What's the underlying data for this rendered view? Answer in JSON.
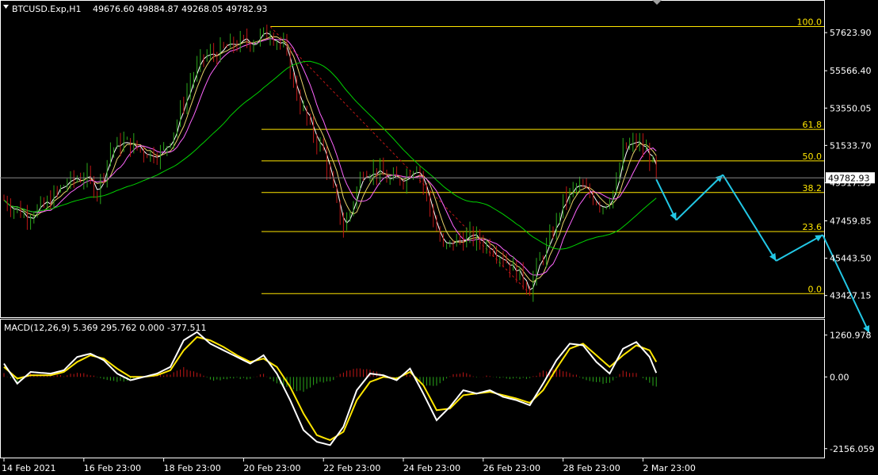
{
  "symbol_header": {
    "symbol": "BTCUSD.Exp,H1",
    "ohlc": "49676.60 49884.87 49268.05 49782.93"
  },
  "macd_header": {
    "label": "MACD(12,26,9) 5.369 295.762 0.000 -377.511"
  },
  "colors": {
    "background": "#000000",
    "grid_frame": "#ffffff",
    "bull": "#2aa81a",
    "bear": "#c01616",
    "ma_fast": "#ffffff",
    "ma_mid": "#e9d26a",
    "ma_slow": "#ff66ff",
    "ma_long": "#00d200",
    "fib": "#ffe600",
    "projection": "#22c8e6",
    "macd_line": "#ffffff",
    "signal_line": "#ffe600"
  },
  "chart_data": [
    {
      "type": "candlestick",
      "title": "BTCUSD.Exp,H1",
      "y_ticks": [
        "57623.90",
        "55566.40",
        "53550.05",
        "51533.70",
        "49517.35",
        "47459.85",
        "45443.50",
        "43427.15"
      ],
      "y_tick_values": [
        57623.9,
        55566.4,
        53550.05,
        51533.7,
        49517.35,
        47459.85,
        45443.5,
        43427.15
      ],
      "ylim": [
        42300,
        59300
      ],
      "current_price": "49782.93",
      "x_ticks": [
        "14 Feb 2021",
        "16 Feb 23:00",
        "18 Feb 23:00",
        "20 Feb 23:00",
        "22 Feb 23:00",
        "24 Feb 23:00",
        "26 Feb 23:00",
        "28 Feb 23:00",
        "2 Mar 23:00"
      ],
      "x_tick_index": [
        0,
        12,
        24,
        36,
        48,
        60,
        72,
        84,
        96
      ],
      "close_path": [
        [
          0,
          48600
        ],
        [
          3,
          47800
        ],
        [
          6,
          48200
        ],
        [
          9,
          49400
        ],
        [
          12,
          49900
        ],
        [
          14,
          49100
        ],
        [
          16,
          51300
        ],
        [
          18,
          51700
        ],
        [
          20,
          51400
        ],
        [
          22,
          51100
        ],
        [
          24,
          51200
        ],
        [
          26,
          52800
        ],
        [
          28,
          55000
        ],
        [
          30,
          56300
        ],
        [
          32,
          56500
        ],
        [
          34,
          56900
        ],
        [
          36,
          57100
        ],
        [
          38,
          57300
        ],
        [
          40,
          57700
        ],
        [
          42,
          56800
        ],
        [
          44,
          54300
        ],
        [
          46,
          52400
        ],
        [
          48,
          51200
        ],
        [
          50,
          48200
        ],
        [
          51,
          47100
        ],
        [
          52,
          48000
        ],
        [
          54,
          50300
        ],
        [
          56,
          50100
        ],
        [
          58,
          49600
        ],
        [
          60,
          49800
        ],
        [
          62,
          50600
        ],
        [
          64,
          48100
        ],
        [
          66,
          45900
        ],
        [
          68,
          46400
        ],
        [
          70,
          46600
        ],
        [
          72,
          46300
        ],
        [
          74,
          45900
        ],
        [
          76,
          45100
        ],
        [
          78,
          44300
        ],
        [
          79,
          43800
        ],
        [
          80,
          44900
        ],
        [
          82,
          46400
        ],
        [
          84,
          48500
        ],
        [
          86,
          49300
        ],
        [
          88,
          48900
        ],
        [
          90,
          48300
        ],
        [
          92,
          49300
        ],
        [
          93,
          51300
        ],
        [
          95,
          51700
        ],
        [
          97,
          51000
        ],
        [
          98,
          49782.93
        ]
      ],
      "fib_levels": [
        {
          "label": "100.0",
          "price": 57950
        },
        {
          "label": "61.8",
          "price": 52400
        },
        {
          "label": "50.0",
          "price": 50700
        },
        {
          "label": "38.2",
          "price": 48990
        },
        {
          "label": "23.6",
          "price": 46880
        },
        {
          "label": "0.0",
          "price": 43530
        }
      ],
      "fib_anchor_index": [
        40,
        79
      ],
      "projection_path": [
        [
          98,
          49700
        ],
        [
          101,
          47500
        ],
        [
          108,
          49950
        ],
        [
          116,
          45300
        ],
        [
          123,
          46700
        ],
        [
          130,
          41400
        ]
      ]
    },
    {
      "type": "histogram+line",
      "title": "MACD(12,26,9)",
      "y_ticks": [
        "1260.978",
        "0.00",
        "-2156.059"
      ],
      "y_tick_values": [
        1260.978,
        0,
        -2156.059
      ],
      "ylim": [
        -2400,
        1700
      ],
      "macd_path": [
        [
          0,
          400
        ],
        [
          2,
          -200
        ],
        [
          4,
          150
        ],
        [
          7,
          100
        ],
        [
          9,
          200
        ],
        [
          11,
          600
        ],
        [
          13,
          700
        ],
        [
          15,
          500
        ],
        [
          17,
          100
        ],
        [
          19,
          -100
        ],
        [
          21,
          0
        ],
        [
          23,
          100
        ],
        [
          25,
          300
        ],
        [
          27,
          1100
        ],
        [
          29,
          1350
        ],
        [
          31,
          1000
        ],
        [
          33,
          800
        ],
        [
          35,
          600
        ],
        [
          37,
          400
        ],
        [
          39,
          650
        ],
        [
          41,
          100
        ],
        [
          43,
          -700
        ],
        [
          45,
          -1600
        ],
        [
          47,
          -1950
        ],
        [
          49,
          -2050
        ],
        [
          51,
          -1500
        ],
        [
          53,
          -400
        ],
        [
          55,
          100
        ],
        [
          57,
          50
        ],
        [
          59,
          -100
        ],
        [
          61,
          250
        ],
        [
          63,
          -500
        ],
        [
          65,
          -1300
        ],
        [
          67,
          -900
        ],
        [
          69,
          -400
        ],
        [
          71,
          -500
        ],
        [
          73,
          -400
        ],
        [
          75,
          -600
        ],
        [
          77,
          -700
        ],
        [
          79,
          -850
        ],
        [
          81,
          -200
        ],
        [
          83,
          500
        ],
        [
          85,
          1000
        ],
        [
          87,
          950
        ],
        [
          89,
          450
        ],
        [
          91,
          100
        ],
        [
          93,
          850
        ],
        [
          95,
          1050
        ],
        [
          97,
          600
        ],
        [
          98,
          120
        ]
      ],
      "signal_path": [
        [
          0,
          300
        ],
        [
          2,
          -50
        ],
        [
          4,
          50
        ],
        [
          7,
          50
        ],
        [
          9,
          150
        ],
        [
          11,
          450
        ],
        [
          13,
          650
        ],
        [
          15,
          550
        ],
        [
          17,
          250
        ],
        [
          19,
          0
        ],
        [
          21,
          0
        ],
        [
          23,
          50
        ],
        [
          25,
          200
        ],
        [
          27,
          800
        ],
        [
          29,
          1200
        ],
        [
          31,
          1100
        ],
        [
          33,
          900
        ],
        [
          35,
          650
        ],
        [
          37,
          450
        ],
        [
          39,
          550
        ],
        [
          41,
          300
        ],
        [
          43,
          -300
        ],
        [
          45,
          -1100
        ],
        [
          47,
          -1750
        ],
        [
          49,
          -1900
        ],
        [
          51,
          -1650
        ],
        [
          53,
          -700
        ],
        [
          55,
          -150
        ],
        [
          57,
          0
        ],
        [
          59,
          -50
        ],
        [
          61,
          150
        ],
        [
          63,
          -250
        ],
        [
          65,
          -1000
        ],
        [
          67,
          -950
        ],
        [
          69,
          -550
        ],
        [
          71,
          -500
        ],
        [
          73,
          -450
        ],
        [
          75,
          -550
        ],
        [
          77,
          -650
        ],
        [
          79,
          -780
        ],
        [
          81,
          -400
        ],
        [
          83,
          250
        ],
        [
          85,
          850
        ],
        [
          87,
          1000
        ],
        [
          89,
          650
        ],
        [
          91,
          300
        ],
        [
          93,
          650
        ],
        [
          95,
          950
        ],
        [
          97,
          800
        ],
        [
          98,
          450
        ]
      ]
    }
  ]
}
